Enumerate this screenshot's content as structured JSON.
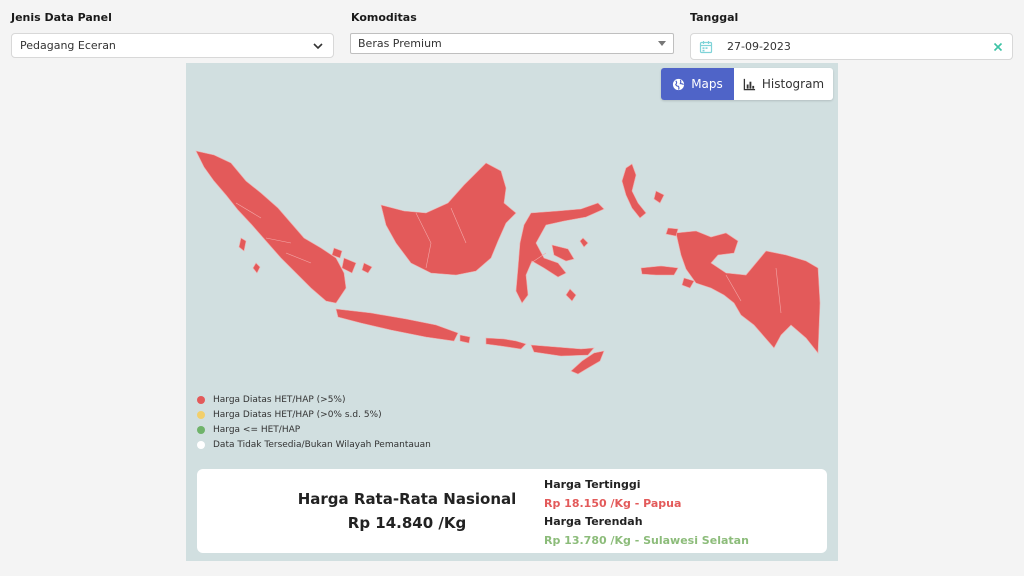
{
  "filters": {
    "panel": {
      "label": "Jenis Data Panel",
      "value": "Pedagang Eceran"
    },
    "commodity": {
      "label": "Komoditas",
      "value": "Beras Premium"
    },
    "date": {
      "label": "Tanggal",
      "value": "27-09-2023"
    }
  },
  "view_toggle": {
    "maps": "Maps",
    "histogram": "Histogram",
    "active": "maps"
  },
  "legend": [
    {
      "label": "Harga Diatas HET/HAP (>5%)",
      "color": "#e35a5a"
    },
    {
      "label": "Harga Diatas HET/HAP (>0% s.d. 5%)",
      "color": "#f2cf6b"
    },
    {
      "label": "Harga <= HET/HAP",
      "color": "#6fb36a"
    },
    {
      "label": "Data Tidak Tersedia/Bukan Wilayah Pemantauan",
      "color": "#ffffff"
    }
  ],
  "summary": {
    "title": "Harga Rata-Rata Nasional",
    "average": "Rp 14.840 /Kg",
    "highest_label": "Harga Tertinggi",
    "highest_value": "Rp 18.150 /Kg - Papua",
    "lowest_label": "Harga Terendah",
    "lowest_value": "Rp 13.780 /Kg - Sulawesi Selatan"
  },
  "colors": {
    "accent": "#4f64c8",
    "map_fill": "#e35a5a",
    "map_bg": "#d1dfe0",
    "clear_icon": "#3cc3a5"
  },
  "icons": [
    "chevron-down-icon",
    "caret-down-icon",
    "calendar-icon",
    "clear-icon",
    "globe-icon",
    "bar-chart-icon"
  ]
}
